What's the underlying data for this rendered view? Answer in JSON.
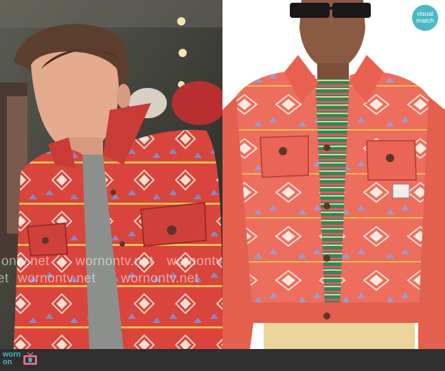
{
  "watermark": {
    "text_1": "ontv.net",
    "text_2": "wornontv.net",
    "text_3": "wornontv.net",
    "text_4": "et",
    "text_5": "wornontv.net",
    "text_6": "wornontv.net"
  },
  "badge": {
    "line1": "visual",
    "line2": "match"
  },
  "logo": {
    "word1": "worn",
    "word2": "on"
  },
  "colors": {
    "jacket_red": "#e0483d",
    "jacket_coral": "#ee6e5d",
    "accent_teal": "#4bb8c4",
    "footer_bg": "#2f2f2f"
  }
}
